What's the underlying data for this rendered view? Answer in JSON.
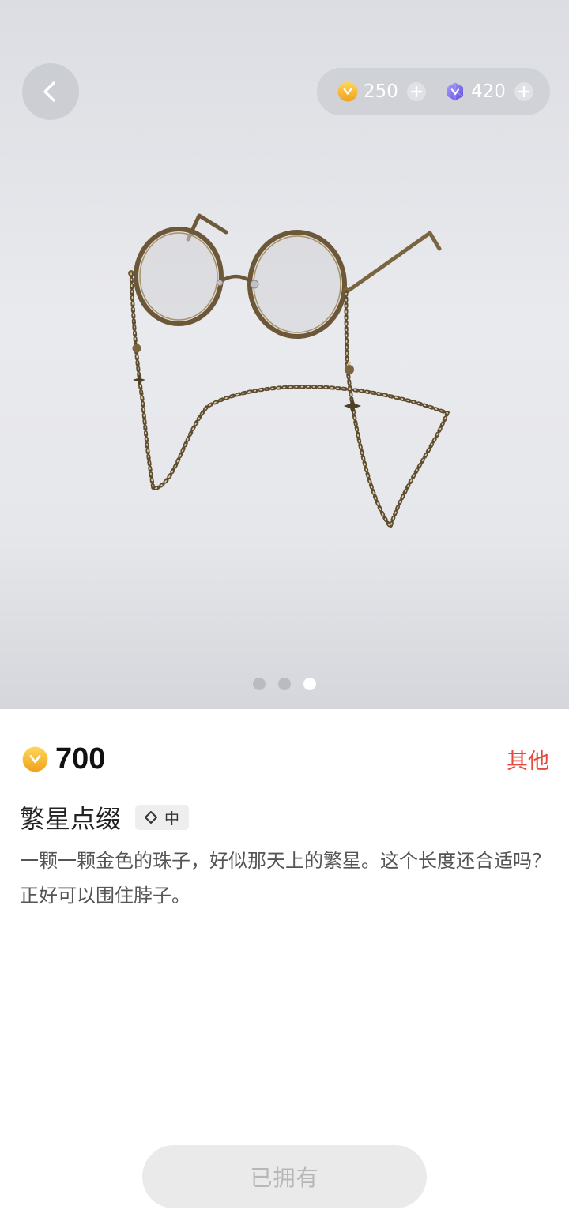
{
  "nav": {
    "back_icon": "chevron-left-icon"
  },
  "wallet": {
    "coins": {
      "icon": "gold-coin-icon",
      "value": "250",
      "add_icon": "plus-icon"
    },
    "gems": {
      "icon": "purple-gem-icon",
      "value": "420",
      "add_icon": "plus-icon"
    }
  },
  "carousel": {
    "total": 3,
    "active_index": 2,
    "image": "round-glasses-with-beaded-chain"
  },
  "item": {
    "price": "700",
    "price_icon": "gold-coin-icon",
    "category": "其他",
    "name": "繁星点缀",
    "rarity": "中",
    "rarity_icon": "diamond-outline-icon",
    "description": "一颗一颗金色的珠子，好似那天上的繁星。这个长度还合适吗？正好可以围住脖子。"
  },
  "action": {
    "label": "已拥有",
    "disabled": true
  },
  "colors": {
    "category": "#e74a3b",
    "coin": "#f5b92a",
    "gem": "#7b6cf0",
    "button_bg": "#eaeaea",
    "button_text": "#b7b7b7"
  }
}
